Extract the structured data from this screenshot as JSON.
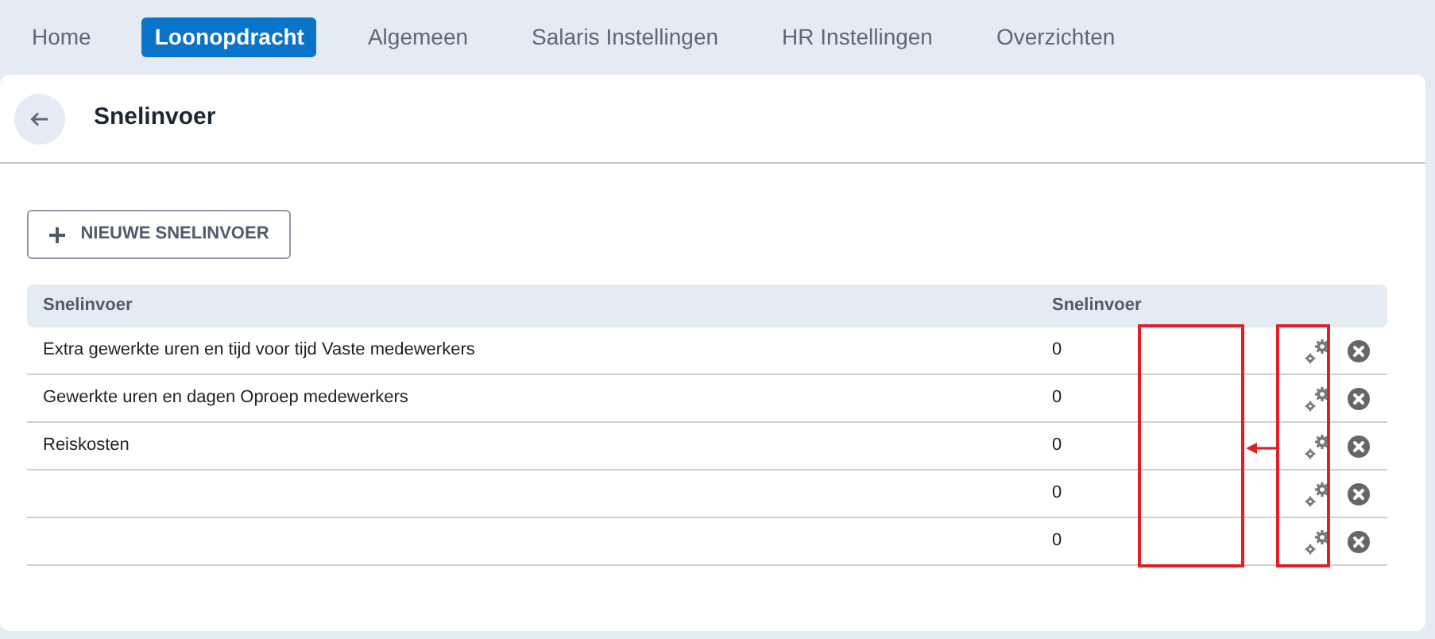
{
  "nav": [
    {
      "label": "Home",
      "selected": false
    },
    {
      "label": "Loonopdracht",
      "selected": true
    },
    {
      "label": "Algemeen",
      "selected": false
    },
    {
      "label": "Salaris Instellingen",
      "selected": false
    },
    {
      "label": "HR Instellingen",
      "selected": false
    },
    {
      "label": "Overzichten",
      "selected": false
    }
  ],
  "page": {
    "title": "Snelinvoer"
  },
  "new_button": {
    "label": "NIEUWE SNELINVOER"
  },
  "table": {
    "columns": [
      "Snelinvoer",
      "Snelinvoer"
    ],
    "rows": [
      {
        "name": "Extra gewerkte uren en tijd voor tijd Vaste medewerkers",
        "count": "0"
      },
      {
        "name": "Gewerkte uren en dagen Oproep medewerkers",
        "count": "0"
      },
      {
        "name": "Reiskosten",
        "count": "0"
      },
      {
        "count": "0"
      },
      {
        "count": "0"
      }
    ]
  }
}
